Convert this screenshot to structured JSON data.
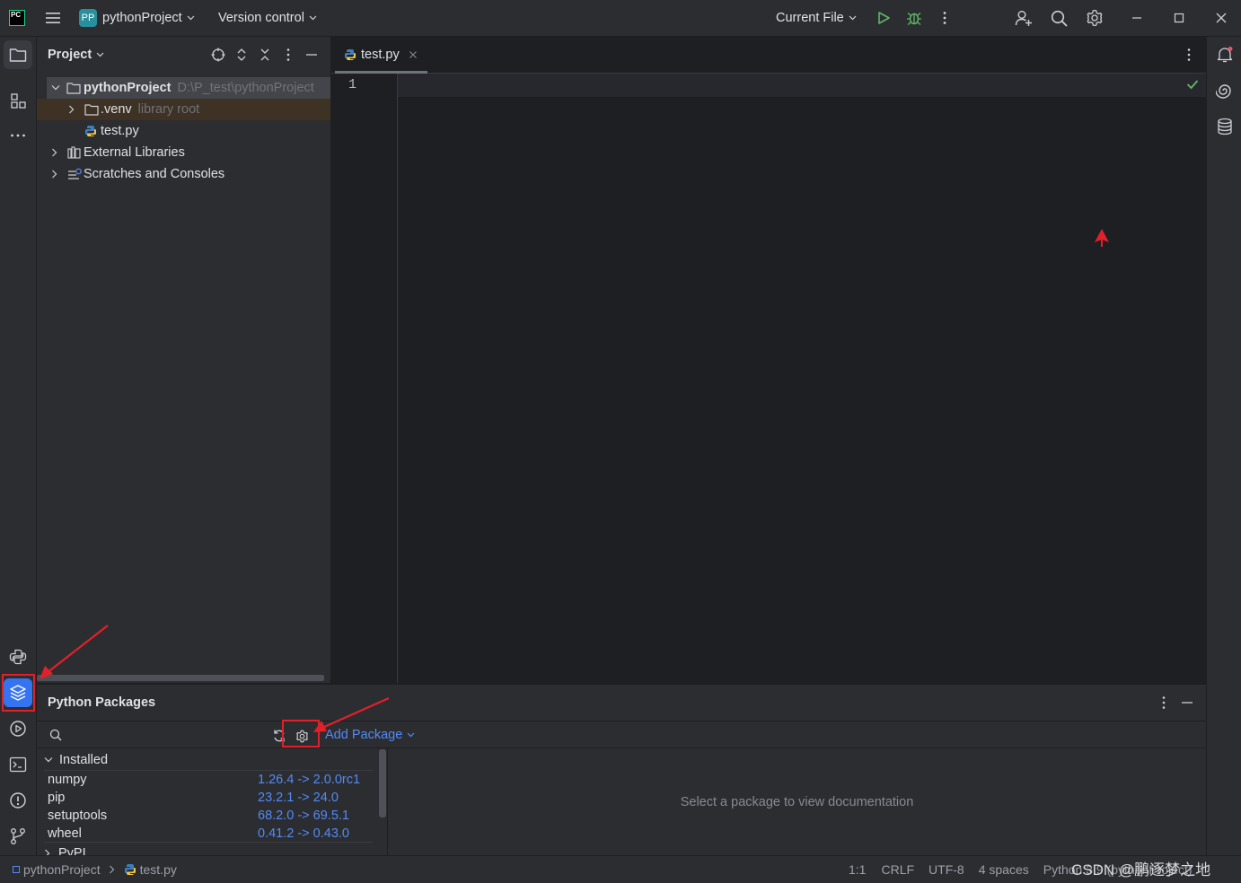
{
  "titlebar": {
    "logo_text": "PC",
    "project_badge": "PP",
    "project_name": "pythonProject",
    "vcs_label": "Version control",
    "run_config": "Current File"
  },
  "project_panel": {
    "title": "Project",
    "tree": [
      {
        "label": "pythonProject",
        "hint": "D:\\P_test\\pythonProject"
      },
      {
        "label": ".venv",
        "hint": "library root"
      },
      {
        "label": "test.py",
        "hint": ""
      },
      {
        "label": "External Libraries",
        "hint": ""
      },
      {
        "label": "Scratches and Consoles",
        "hint": ""
      }
    ]
  },
  "editor": {
    "tab_label": "test.py",
    "line_number": "1"
  },
  "packages_panel": {
    "title": "Python Packages",
    "add_package_label": "Add Package",
    "installed_label": "Installed",
    "packages": [
      {
        "name": "numpy",
        "version": "1.26.4 -> 2.0.0rc1"
      },
      {
        "name": "pip",
        "version": "23.2.1 -> 24.0"
      },
      {
        "name": "setuptools",
        "version": "68.2.0 -> 69.5.1"
      },
      {
        "name": "wheel",
        "version": "0.41.2 -> 0.43.0"
      }
    ],
    "pypi_label": "PyPI",
    "doc_placeholder": "Select a package to view documentation"
  },
  "statusbar": {
    "breadcrumb_project": "pythonProject",
    "breadcrumb_file": "test.py",
    "position": "1:1",
    "line_sep": "CRLF",
    "encoding": "UTF-8",
    "indent": "4 spaces",
    "interpreter": "Python 3.9 (pythonProject)",
    "watermark": "CSDN @鹏逐梦之地"
  },
  "colors": {
    "accent": "#3574f0",
    "annotation_red": "#e2202a",
    "link_blue": "#548af7",
    "run_green": "#5fb865",
    "debug_green": "#5fb865"
  }
}
